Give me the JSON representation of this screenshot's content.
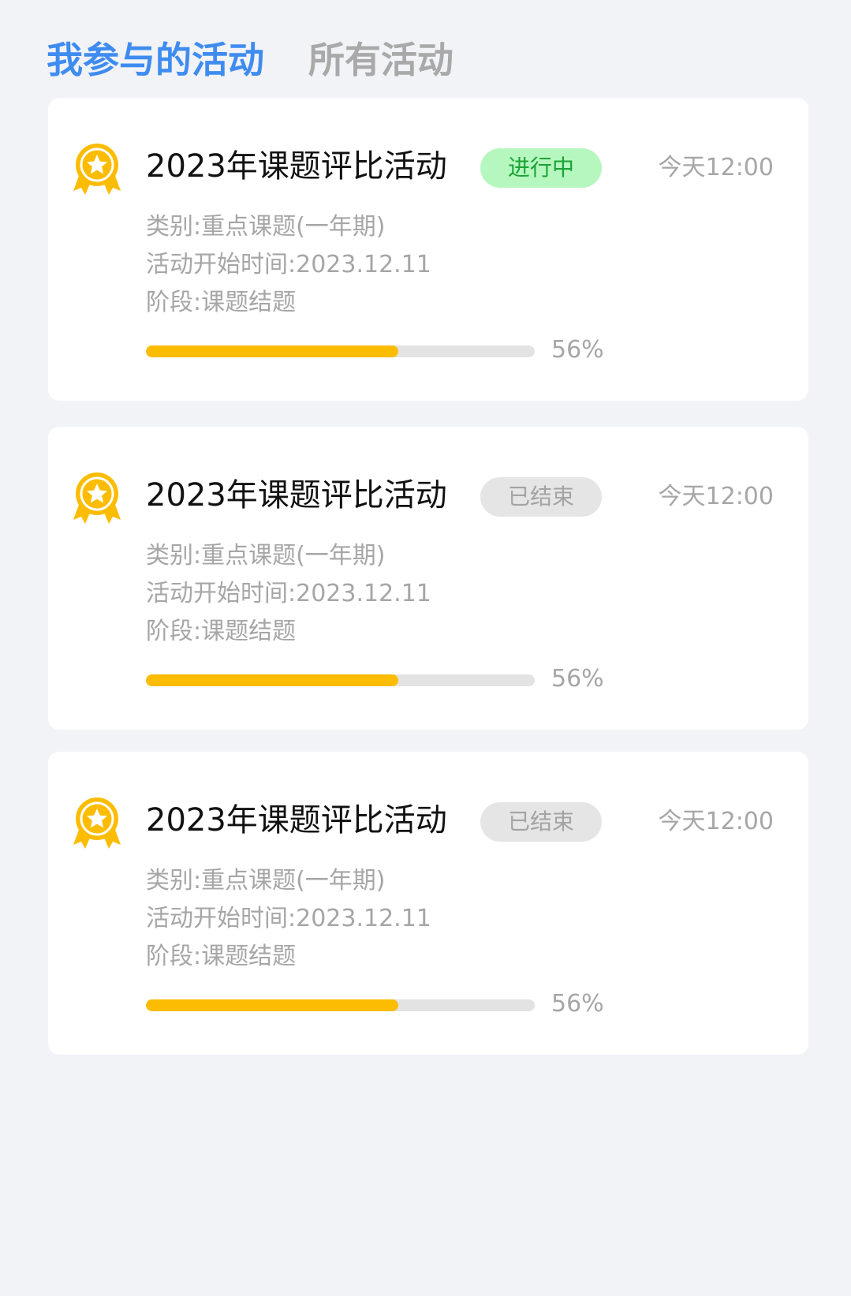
{
  "tabs": [
    {
      "label": "我参与的活动",
      "active": true
    },
    {
      "label": "所有活动",
      "active": false
    }
  ],
  "cards": [
    {
      "title": "2023年课题评比活动",
      "status": "进行中",
      "status_type": "ongoing",
      "time": "今天12:00",
      "category": "类别:重点课题(一年期)",
      "start": "活动开始时间:2023.12.11",
      "stage": "阶段:课题结题",
      "progress_label": "56%",
      "progress": 0.65,
      "icon": "medal-icon"
    },
    {
      "title": "2023年课题评比活动",
      "status": "已结束",
      "status_type": "ended",
      "time": "今天12:00",
      "category": "类别:重点课题(一年期)",
      "start": "活动开始时间:2023.12.11",
      "stage": "阶段:课题结题",
      "progress_label": "56%",
      "progress": 0.65,
      "icon": "medal-icon"
    },
    {
      "title": "2023年课题评比活动",
      "status": "已结束",
      "status_type": "ended",
      "time": "今天12:00",
      "category": "类别:重点课题(一年期)",
      "start": "活动开始时间:2023.12.11",
      "stage": "阶段:课题结题",
      "progress_label": "56%",
      "progress": 0.65,
      "icon": "medal-icon"
    }
  ],
  "colors": {
    "accent": "#3f8cf0",
    "medal": "#fcbc02",
    "progress": "#fcbc02",
    "ongoing_bg": "#b6f7c0",
    "ongoing_text": "#1aa334",
    "ended_bg": "#e5e5e5",
    "ended_text": "#a3a3a3"
  }
}
